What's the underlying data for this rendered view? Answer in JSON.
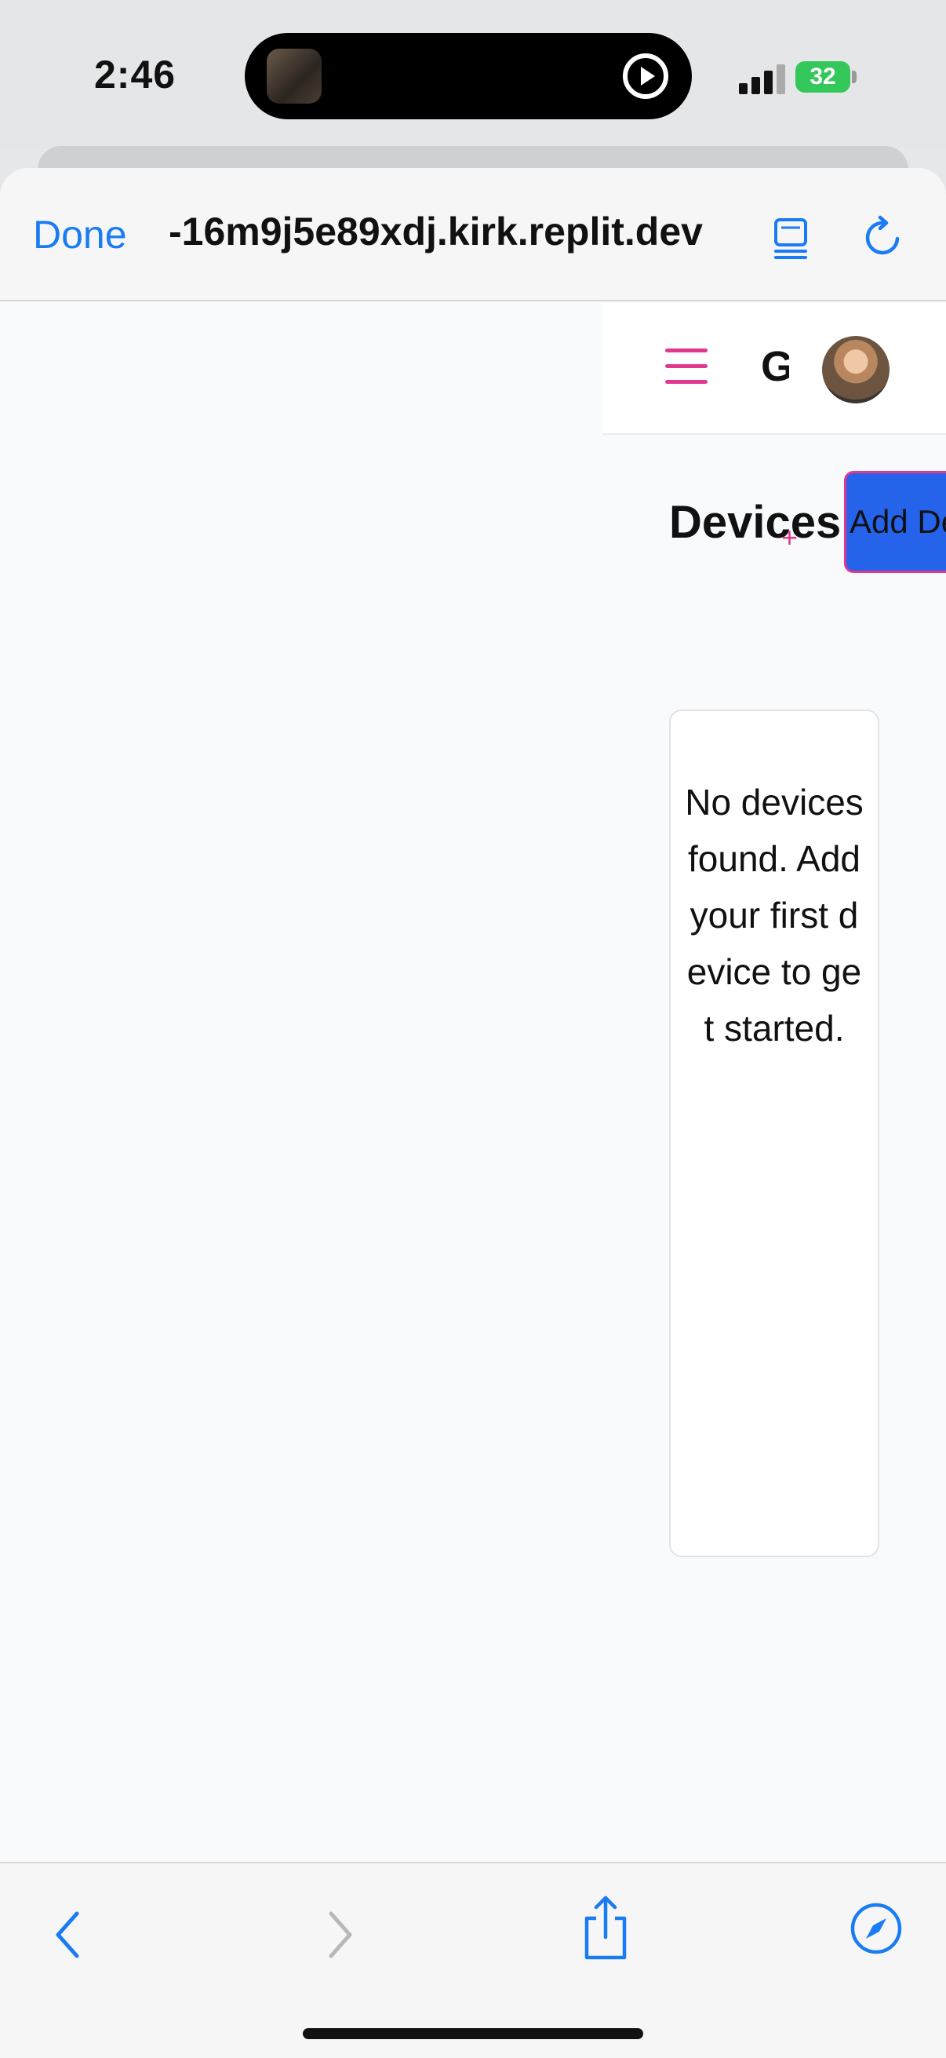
{
  "status_bar": {
    "time": "2:46",
    "battery": "32",
    "icons": [
      "now-playing-icon",
      "play-icon",
      "signal-icon",
      "battery-icon"
    ]
  },
  "browser": {
    "done_label": "Done",
    "url": "-16m9j5e89xdj.kirk.replit.dev",
    "accent": "#1a7cf5",
    "icons": [
      "reader-icon",
      "reload-icon",
      "back-icon",
      "forward-icon",
      "share-icon",
      "compass-icon"
    ]
  },
  "app": {
    "brand_initial": "G",
    "page_title": "Devices",
    "add_button_label": "Add De",
    "add_button_icon": "+",
    "empty_state": "No devices found. Add your first device to get started.",
    "primary_color": "#2563eb",
    "accent_color": "#e0388f"
  }
}
